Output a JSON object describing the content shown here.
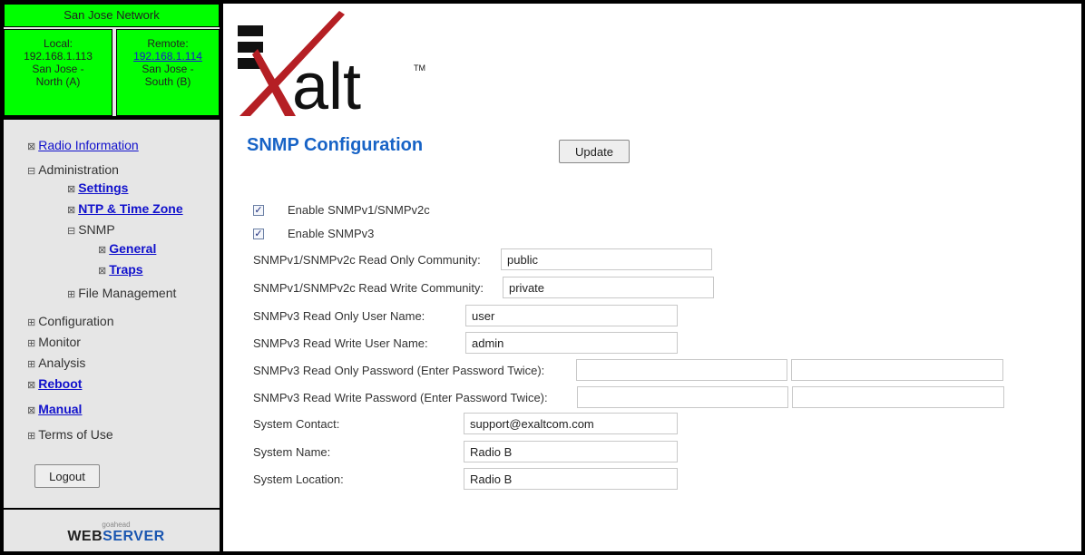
{
  "network": {
    "title": "San Jose Network",
    "local": {
      "heading": "Local:",
      "ip": "192.168.1.113",
      "name_line1": "San Jose -",
      "name_line2": "North (A)"
    },
    "remote": {
      "heading": "Remote:",
      "ip": "192.168.1.114",
      "name_line1": "San Jose -",
      "name_line2": "South (B)"
    }
  },
  "nav": {
    "radio_information": "Radio Information",
    "administration": "Administration",
    "settings": "Settings",
    "ntp_time_zone": "NTP & Time Zone",
    "snmp": "SNMP",
    "general": "General",
    "traps": "Traps",
    "file_management": "File Management",
    "configuration": "Configuration",
    "monitor": "Monitor",
    "analysis": "Analysis",
    "reboot": "Reboot",
    "manual": "Manual",
    "terms_of_use": "Terms of Use",
    "logout": "Logout"
  },
  "icons": {
    "collapsed": "⊞",
    "expanded": "⊟",
    "page": "⊠"
  },
  "footer": {
    "small": "goahead",
    "web": "WEB",
    "server": "SERVER"
  },
  "logo": {
    "text": "alt",
    "tm": "TM"
  },
  "main": {
    "title": "SNMP Configuration",
    "update": "Update",
    "enable_v1v2c": {
      "label": "Enable SNMPv1/SNMPv2c",
      "checked": true
    },
    "enable_v3": {
      "label": "Enable SNMPv3",
      "checked": true
    },
    "fields": {
      "ro_community": {
        "label": "SNMPv1/SNMPv2c Read Only Community:",
        "value": "public"
      },
      "rw_community": {
        "label": "SNMPv1/SNMPv2c Read Write Community:",
        "value": "private"
      },
      "ro_user": {
        "label": "SNMPv3 Read Only User Name:",
        "value": "user"
      },
      "rw_user": {
        "label": "SNMPv3 Read Write User Name:",
        "value": "admin"
      },
      "ro_password": {
        "label": "SNMPv3 Read Only Password (Enter Password Twice):",
        "value": "",
        "confirm": ""
      },
      "rw_password": {
        "label": "SNMPv3 Read Write Password (Enter Password Twice):",
        "value": "",
        "confirm": ""
      },
      "contact": {
        "label": "System Contact:",
        "value": "support@exaltcom.com"
      },
      "name": {
        "label": "System Name:",
        "value": "Radio B"
      },
      "location": {
        "label": "System Location:",
        "value": "Radio B"
      }
    }
  },
  "colors": {
    "network_green": "#00ff00",
    "title_blue": "#1763c6",
    "link_blue": "#1111cc",
    "logo_red": "#b51f24"
  }
}
